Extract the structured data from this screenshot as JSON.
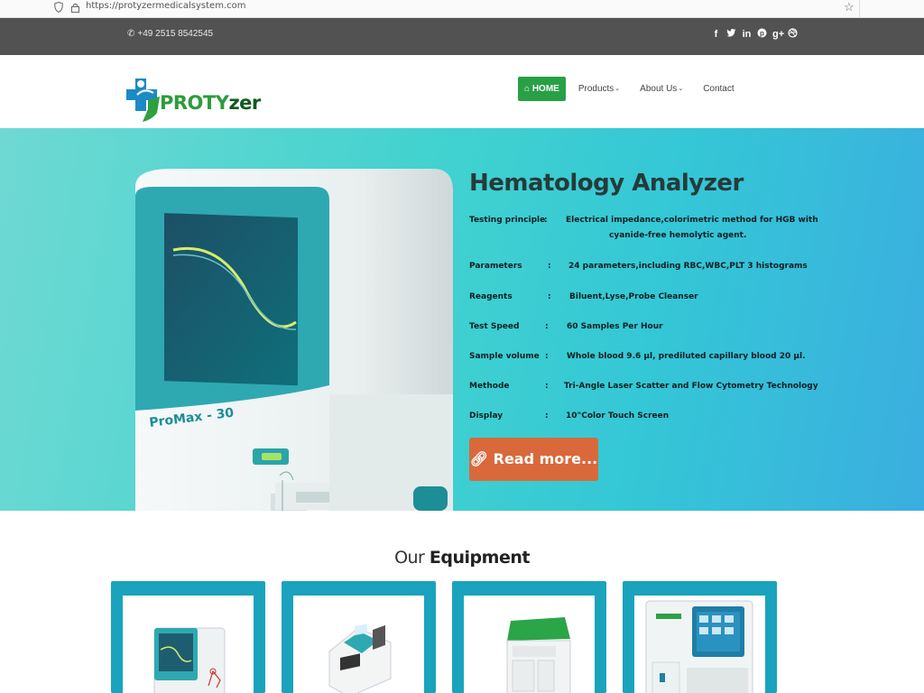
{
  "browser": {
    "url": "https://protyzermedicalsystem.com"
  },
  "topbar": {
    "phone": "+49 2515 8542545",
    "social": [
      {
        "name": "facebook-icon",
        "glyph": "f"
      },
      {
        "name": "twitter-icon",
        "glyph": "t"
      },
      {
        "name": "linkedin-icon",
        "glyph": "in"
      },
      {
        "name": "pinterest-icon",
        "glyph": "p"
      },
      {
        "name": "google-plus-icon",
        "glyph": "g+"
      },
      {
        "name": "dribbble-icon",
        "glyph": "d"
      }
    ]
  },
  "logo": {
    "text_a": "PROTY",
    "text_b": "zer"
  },
  "nav": {
    "home": "HOME",
    "products": "Products",
    "about": "About Us",
    "contact": "Contact"
  },
  "hero": {
    "title": "Hematology Analyzer",
    "device_label": "ProMax - 30",
    "specs": [
      {
        "key": "Testing principle",
        "value": "Electrical impedance,colorimetric method for HGB with",
        "value2": "cyanide-free hemolytic agent."
      },
      {
        "key": "Parameters",
        "value": "24 parameters,including RBC,WBC,PLT 3 histograms"
      },
      {
        "key": "Reagents",
        "value": "Biluent,Lyse,Probe Cleanser"
      },
      {
        "key": "Test Speed",
        "value": "60 Samples Per Hour"
      },
      {
        "key": "Sample volume",
        "value": "Whole blood 9.6 µl, prediluted capillary blood 20 µl."
      },
      {
        "key": "Methode",
        "value": "Tri-Angle Laser Scatter and Flow Cytometry Technology"
      },
      {
        "key": "Display",
        "value": "10\"Color Touch Screen"
      }
    ],
    "read_more": "Read more..."
  },
  "equipment": {
    "title_light": "Our ",
    "title_bold": "Equipment"
  },
  "colors": {
    "home_green": "#27a046",
    "read_more": "#d9693a",
    "card_teal": "#1aa3bd"
  }
}
